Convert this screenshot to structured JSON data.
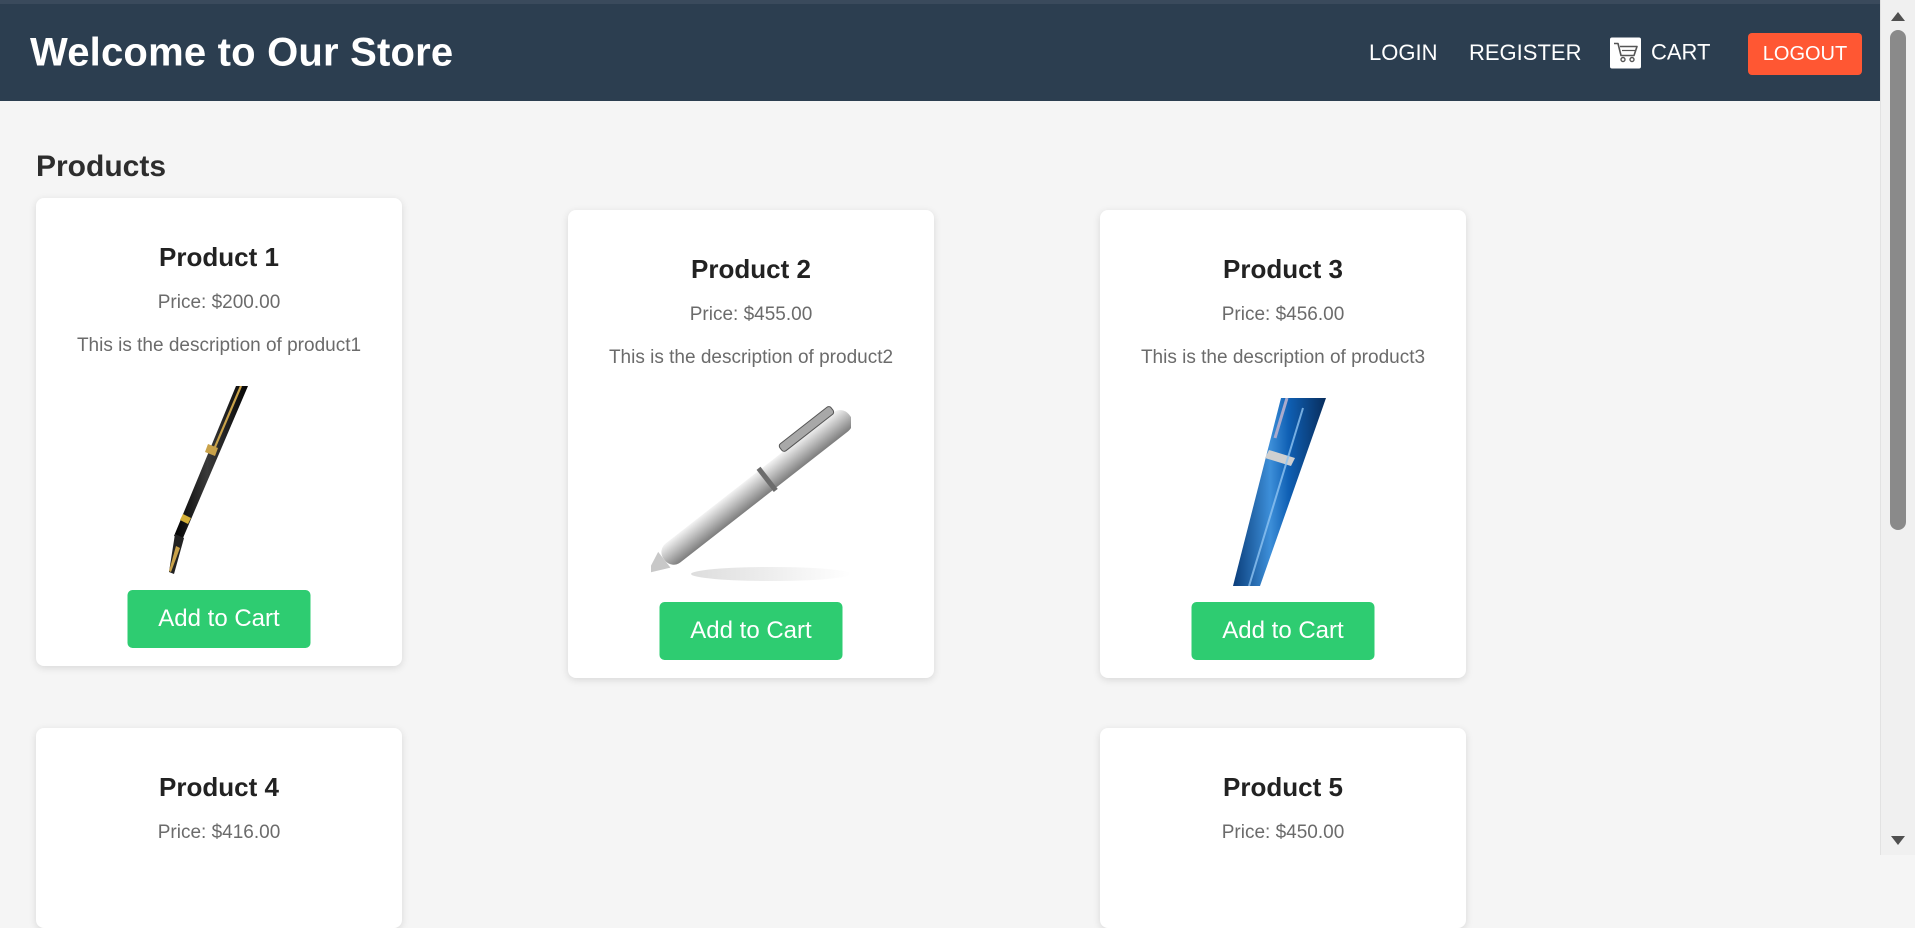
{
  "header": {
    "title": "Welcome to Our Store",
    "nav": {
      "login": "Login",
      "register": "Register",
      "cart": "Cart",
      "logout": "Logout"
    }
  },
  "main": {
    "section_title": "Products",
    "products": [
      {
        "name": "Product 1",
        "price": "Price: $200.00",
        "description": "This is the description of product1",
        "button": "Add to Cart",
        "image": "black-gold-fountain-pen"
      },
      {
        "name": "Product 2",
        "price": "Price: $455.00",
        "description": "This is the description of product2",
        "button": "Add to Cart",
        "image": "silver-ballpoint-pen"
      },
      {
        "name": "Product 3",
        "price": "Price: $456.00",
        "description": "This is the description of product3",
        "button": "Add to Cart",
        "image": "blue-ballpoint-pen"
      },
      {
        "name": "Product 4",
        "price": "Price: $416.00"
      },
      {
        "name": "Product 5",
        "price": "Price: $450.00"
      }
    ]
  },
  "colors": {
    "header_bg": "#2c3e50",
    "logout_bg": "#ff5733",
    "add_to_cart_bg": "#2ecc71",
    "page_bg": "#f5f5f5"
  }
}
